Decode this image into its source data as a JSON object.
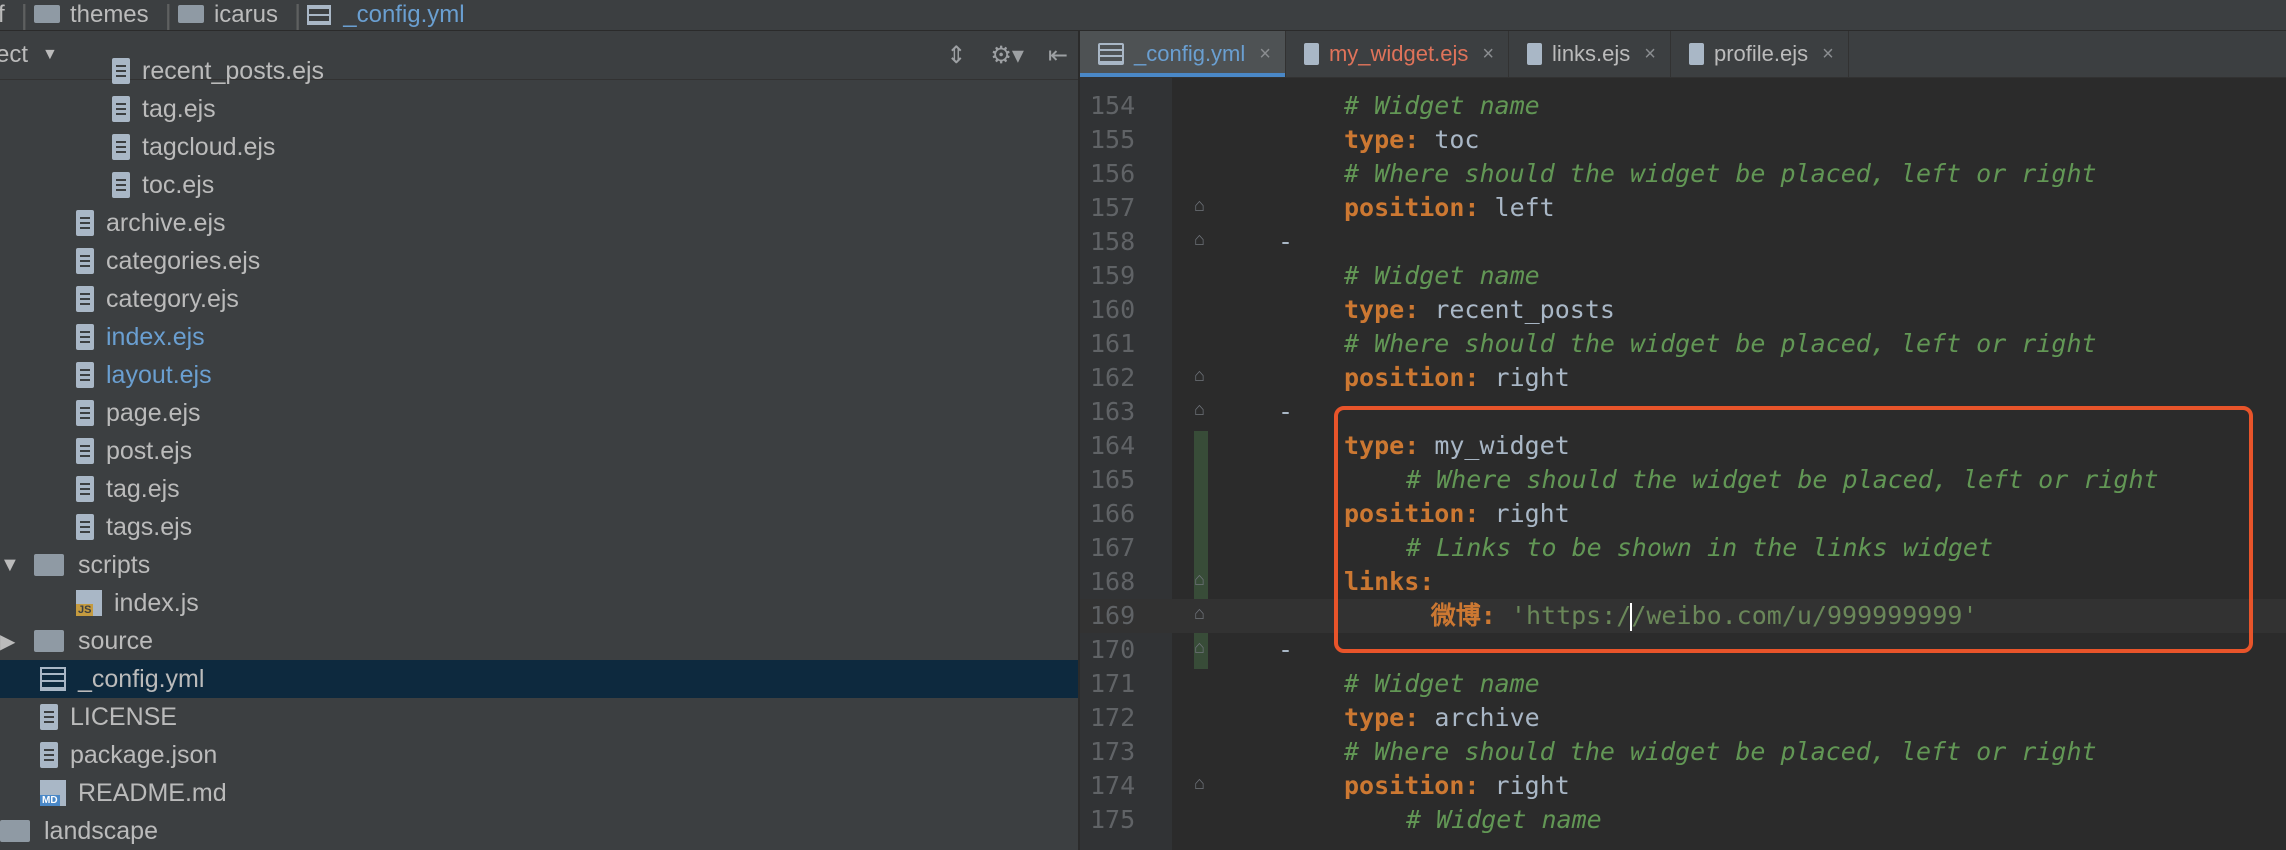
{
  "breadcrumb": [
    {
      "label": "themes",
      "type": "folder"
    },
    {
      "label": "icarus",
      "type": "folder"
    },
    {
      "label": "_config.yml",
      "type": "file"
    }
  ],
  "project_panel": {
    "title": "ect",
    "tree": [
      {
        "label": "recent_posts.ejs",
        "icon": "file-icon",
        "depth": 3,
        "state": "normal"
      },
      {
        "label": "tag.ejs",
        "icon": "file-icon",
        "depth": 3,
        "state": "normal"
      },
      {
        "label": "tagcloud.ejs",
        "icon": "file-icon",
        "depth": 3,
        "state": "normal"
      },
      {
        "label": "toc.ejs",
        "icon": "file-icon",
        "depth": 3,
        "state": "normal"
      },
      {
        "label": "archive.ejs",
        "icon": "file-icon",
        "depth": 2,
        "state": "normal"
      },
      {
        "label": "categories.ejs",
        "icon": "file-icon",
        "depth": 2,
        "state": "normal"
      },
      {
        "label": "category.ejs",
        "icon": "file-icon",
        "depth": 2,
        "state": "normal"
      },
      {
        "label": "index.ejs",
        "icon": "file-icon",
        "depth": 2,
        "state": "modified"
      },
      {
        "label": "layout.ejs",
        "icon": "file-icon",
        "depth": 2,
        "state": "modified"
      },
      {
        "label": "page.ejs",
        "icon": "file-icon",
        "depth": 2,
        "state": "normal"
      },
      {
        "label": "post.ejs",
        "icon": "file-icon",
        "depth": 2,
        "state": "normal"
      },
      {
        "label": "tag.ejs",
        "icon": "file-icon",
        "depth": 2,
        "state": "normal"
      },
      {
        "label": "tags.ejs",
        "icon": "file-icon",
        "depth": 2,
        "state": "normal"
      },
      {
        "label": "scripts",
        "icon": "folder-icon",
        "depth": 1,
        "state": "expanded"
      },
      {
        "label": "index.js",
        "icon": "js-file-icon",
        "depth": 2,
        "state": "normal"
      },
      {
        "label": "source",
        "icon": "folder-icon",
        "depth": 1,
        "state": "collapsed"
      },
      {
        "label": "_config.yml",
        "icon": "yml-file-icon",
        "depth": 1,
        "state": "selected"
      },
      {
        "label": "LICENSE",
        "icon": "file-icon",
        "depth": 1,
        "state": "normal"
      },
      {
        "label": "package.json",
        "icon": "json-file-icon",
        "depth": 1,
        "state": "normal"
      },
      {
        "label": "README.md",
        "icon": "md-file-icon",
        "depth": 1,
        "state": "normal"
      },
      {
        "label": "landscape",
        "icon": "folder-icon",
        "depth": 0,
        "state": "collapsed"
      }
    ]
  },
  "tabs": [
    {
      "label": "_config.yml",
      "icon": "yml-file-icon",
      "active": true,
      "color": "#6a9fd1"
    },
    {
      "label": "my_widget.ejs",
      "icon": "file-icon",
      "active": false,
      "color": "#e0735a"
    },
    {
      "label": "links.ejs",
      "icon": "file-icon",
      "active": false,
      "color": "#bbbbbb"
    },
    {
      "label": "profile.ejs",
      "icon": "file-icon",
      "active": false,
      "color": "#bbbbbb"
    }
  ],
  "code_lines": [
    {
      "n": "154",
      "parts": [
        [
          "cm",
          "# Widget name"
        ]
      ],
      "indent": 0
    },
    {
      "n": "155",
      "parts": [
        [
          "key",
          "type:"
        ],
        [
          "val",
          " toc"
        ]
      ],
      "indent": 0
    },
    {
      "n": "156",
      "parts": [
        [
          "cm",
          "# Where should the widget be placed, left or right"
        ]
      ],
      "indent": 0
    },
    {
      "n": "157",
      "parts": [
        [
          "key",
          "position:"
        ],
        [
          "val",
          " left"
        ]
      ],
      "indent": 0
    },
    {
      "n": "158",
      "parts": [
        [
          "dash",
          "-"
        ]
      ],
      "indent": -1
    },
    {
      "n": "159",
      "parts": [
        [
          "cm",
          "# Widget name"
        ]
      ],
      "indent": 0
    },
    {
      "n": "160",
      "parts": [
        [
          "key",
          "type:"
        ],
        [
          "val",
          " recent_posts"
        ]
      ],
      "indent": 0
    },
    {
      "n": "161",
      "parts": [
        [
          "cm",
          "# Where should the widget be placed, left or right"
        ]
      ],
      "indent": 0
    },
    {
      "n": "162",
      "parts": [
        [
          "key",
          "position:"
        ],
        [
          "val",
          " right"
        ]
      ],
      "indent": 0
    },
    {
      "n": "163",
      "parts": [
        [
          "dash",
          "-"
        ]
      ],
      "indent": -1
    },
    {
      "n": "164",
      "parts": [
        [
          "key",
          "type:"
        ],
        [
          "val",
          " my_widget"
        ]
      ],
      "indent": 0
    },
    {
      "n": "165",
      "parts": [
        [
          "cm",
          "# Where should the widget be placed, left or right"
        ]
      ],
      "indent": 1
    },
    {
      "n": "166",
      "parts": [
        [
          "key",
          "position:"
        ],
        [
          "val",
          " right"
        ]
      ],
      "indent": 0
    },
    {
      "n": "167",
      "parts": [
        [
          "cm",
          "# Links to be shown in the links widget"
        ]
      ],
      "indent": 1
    },
    {
      "n": "168",
      "parts": [
        [
          "key",
          "links:"
        ]
      ],
      "indent": 0
    },
    {
      "n": "169",
      "parts": [
        [
          "key",
          "微博:"
        ],
        [
          "str",
          " 'https:/"
        ],
        [
          "caret",
          ""
        ],
        [
          "str",
          "/weibo.com/u/999999999'"
        ]
      ],
      "indent": 1.4
    },
    {
      "n": "170",
      "parts": [
        [
          "dash",
          "-"
        ]
      ],
      "indent": -1
    },
    {
      "n": "171",
      "parts": [
        [
          "cm",
          "# Widget name"
        ]
      ],
      "indent": 0
    },
    {
      "n": "172",
      "parts": [
        [
          "key",
          "type:"
        ],
        [
          "val",
          " archive"
        ]
      ],
      "indent": 0
    },
    {
      "n": "173",
      "parts": [
        [
          "cm",
          "# Where should the widget be placed, left or right"
        ]
      ],
      "indent": 0
    },
    {
      "n": "174",
      "parts": [
        [
          "key",
          "position:"
        ],
        [
          "val",
          " right"
        ]
      ],
      "indent": 0
    },
    {
      "n": "175",
      "parts": [
        [
          "cm",
          "# Widget name"
        ]
      ],
      "indent": 1
    }
  ],
  "current_line": "169",
  "colors": {
    "accent": "#4a88c7",
    "highlight_box": "#e8542a",
    "comment": "#629755",
    "keyword": "#cc7832",
    "string": "#6a8759"
  }
}
